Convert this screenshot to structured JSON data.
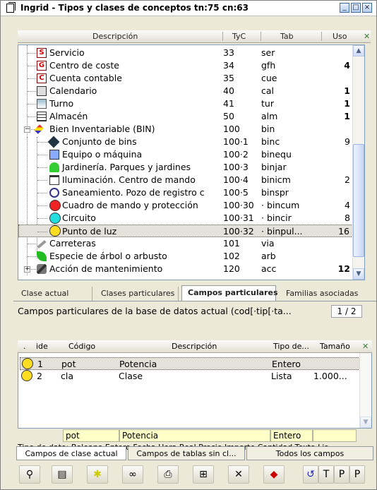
{
  "window": {
    "title": "Ingrid - Tipos y clases de conceptos tn:75 cn:63",
    "controls": [
      "_",
      "□",
      "×"
    ]
  },
  "table_header": {
    "descripcion": "Descripción",
    "tyc": "TyC",
    "tab": "Tab",
    "uso": "Uso"
  },
  "tree_rows": [
    {
      "label": "Servicio",
      "tyc": "33",
      "tab": "ser",
      "uso": "",
      "icon": "S"
    },
    {
      "label": "Centro de coste",
      "tyc": "34",
      "tab": "gfh",
      "uso": "4",
      "icon": "G"
    },
    {
      "label": "Cuenta contable",
      "tyc": "35",
      "tab": "cue",
      "uso": "",
      "icon": "C"
    },
    {
      "label": "Calendario",
      "tyc": "40",
      "tab": "cal",
      "uso": "1",
      "icon": "calendar-icon"
    },
    {
      "label": "Turno",
      "tyc": "41",
      "tab": "tur",
      "uso": "1",
      "icon": "shift-icon"
    },
    {
      "label": "Almacén",
      "tyc": "50",
      "tab": "alm",
      "uso": "1",
      "icon": "warehouse-icon"
    },
    {
      "label": "Bien Inventariable (BIN)",
      "tyc": "100",
      "tab": "bin",
      "uso": "",
      "icon": "bin-icon"
    },
    {
      "label": "Conjunto de bins",
      "tyc": "100·1",
      "tab": "binc",
      "uso": "9",
      "icon": "diamond-icon"
    },
    {
      "label": "Equipo o máquina",
      "tyc": "100·2",
      "tab": "binequ",
      "uso": "",
      "icon": "computer-icon"
    },
    {
      "label": "Jardinería. Parques y jardines",
      "tyc": "100·3",
      "tab": "binjar",
      "uso": "",
      "icon": "tree-icon"
    },
    {
      "label": "Iluminación. Centro de mando",
      "tyc": "100·4",
      "tab": "binicm",
      "uso": "2",
      "icon": "lamp-icon"
    },
    {
      "label": "Saneamiento. Pozo de registro c",
      "tyc": "100·5",
      "tab": "binspr",
      "uso": "",
      "icon": "well-icon"
    },
    {
      "label": "Cuadro de mando y protección",
      "tyc": "100·30",
      "tab": "· bincum",
      "uso": "4",
      "icon": "red-circle-icon"
    },
    {
      "label": "Circuito",
      "tyc": "100·31",
      "tab": "· bincir",
      "uso": "8",
      "icon": "cyan-circle-icon"
    },
    {
      "label": "Punto de luz",
      "tyc": "100·32",
      "tab": "· binpul...",
      "uso": "16",
      "icon": "yellow-circle-icon"
    },
    {
      "label": "Carreteras",
      "tyc": "101",
      "tab": "via",
      "uso": "",
      "icon": "road-icon"
    },
    {
      "label": "Especie de árbol o arbusto",
      "tyc": "102",
      "tab": "arb",
      "uso": "",
      "icon": "leaf-icon"
    },
    {
      "label": "Acción de mantenimiento",
      "tyc": "120",
      "tab": "acc",
      "uso": "12",
      "icon": "tools-icon"
    }
  ],
  "tabs": [
    "Clase actual",
    "Clases particulares",
    "Campos particulares",
    "Familias asociadas"
  ],
  "panel": {
    "title": "Campos particulares de la base de datos actual (cod[·tip[·ta...",
    "pager": "1 / 2"
  },
  "grid_header": {
    "dot": ".",
    "ide": "ide",
    "codigo": "Código",
    "descripcion": "Descripción",
    "tipo": "Tipo de...",
    "tamano": "Tamaño"
  },
  "grid_rows": [
    {
      "ide": "1",
      "codigo": "pot",
      "descripcion": "Potencia",
      "tipo": "Entero",
      "tamano": ""
    },
    {
      "ide": "2",
      "codigo": "cla",
      "descripcion": "Clase",
      "tipo": "Lista",
      "tamano": "1.000..."
    }
  ],
  "edit_fields": {
    "codigo": "pot",
    "descripcion": "Potencia",
    "tipo": "Entero",
    "tamano": ""
  },
  "type_line": "Tipo de dato: Boleano Entero Fecha Hora Real Precio Importe Cantidad Texto Lis...",
  "bottom_tabs": [
    "Campos de clase actual",
    "Campos de tablas sin cl...",
    "Todos los campos"
  ],
  "toolbar_icons": [
    "binoculars-icon",
    "document-icon",
    "asterisk-icon",
    "link-icon",
    "printer-icon",
    "layout-icon",
    "delete-icon",
    "book-icon",
    "undo-icon",
    "bracket-t-icon",
    "bracket-p-icon",
    "bracket-p2-icon"
  ],
  "colors": {
    "tab_bar": "#ece9d8",
    "selection": "#e3e1da",
    "field_bg": "#ffffc8"
  }
}
